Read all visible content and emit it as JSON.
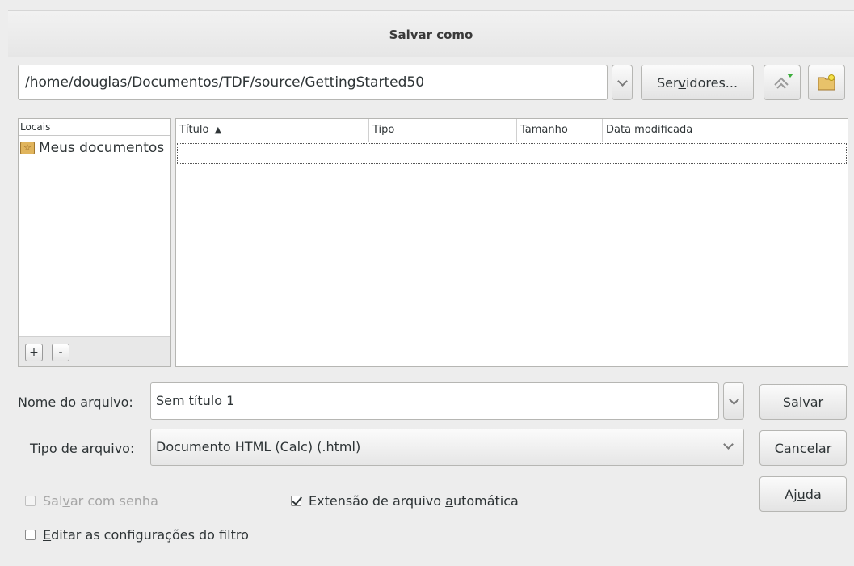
{
  "window": {
    "title": "Salvar como"
  },
  "toolbar": {
    "path": "/home/douglas/Documentos/TDF/source/GettingStarted50",
    "servers_label_pre": "Ser",
    "servers_label_acc": "v",
    "servers_label_post": "idores...",
    "up_icon": "up-level-icon",
    "new_folder_icon": "new-folder-icon"
  },
  "places": {
    "header": "Locais",
    "items": [
      {
        "label": "Meus documentos",
        "icon": "star-folder-icon"
      }
    ],
    "add_label": "+",
    "remove_label": "-"
  },
  "files": {
    "columns": [
      {
        "label": "Título",
        "sort": "ascending"
      },
      {
        "label": "Tipo"
      },
      {
        "label": "Tamanho"
      },
      {
        "label": "Data modificada"
      }
    ],
    "sort_indicator": "▲"
  },
  "form": {
    "filename_label_acc": "N",
    "filename_label_rest": "ome do arquivo:",
    "filename_value": "Sem título 1",
    "filetype_label_acc": "T",
    "filetype_label_rest": "ipo de arquivo:",
    "filetype_value": "Documento HTML (Calc) (.html)"
  },
  "buttons": {
    "save_acc": "S",
    "save_rest": "alvar",
    "cancel_acc": "C",
    "cancel_rest": "ancelar",
    "help_pre": "Aj",
    "help_acc": "u",
    "help_post": "da"
  },
  "options": {
    "password_pre": "Sal",
    "password_acc": "v",
    "password_post": "ar com senha",
    "password_checked": false,
    "password_enabled": false,
    "autoext_pre": "Extensão de arquivo ",
    "autoext_acc": "a",
    "autoext_post": "utomática",
    "autoext_checked": true,
    "filter_acc": "E",
    "filter_rest": "ditar as configurações do filtro",
    "filter_checked": false
  }
}
